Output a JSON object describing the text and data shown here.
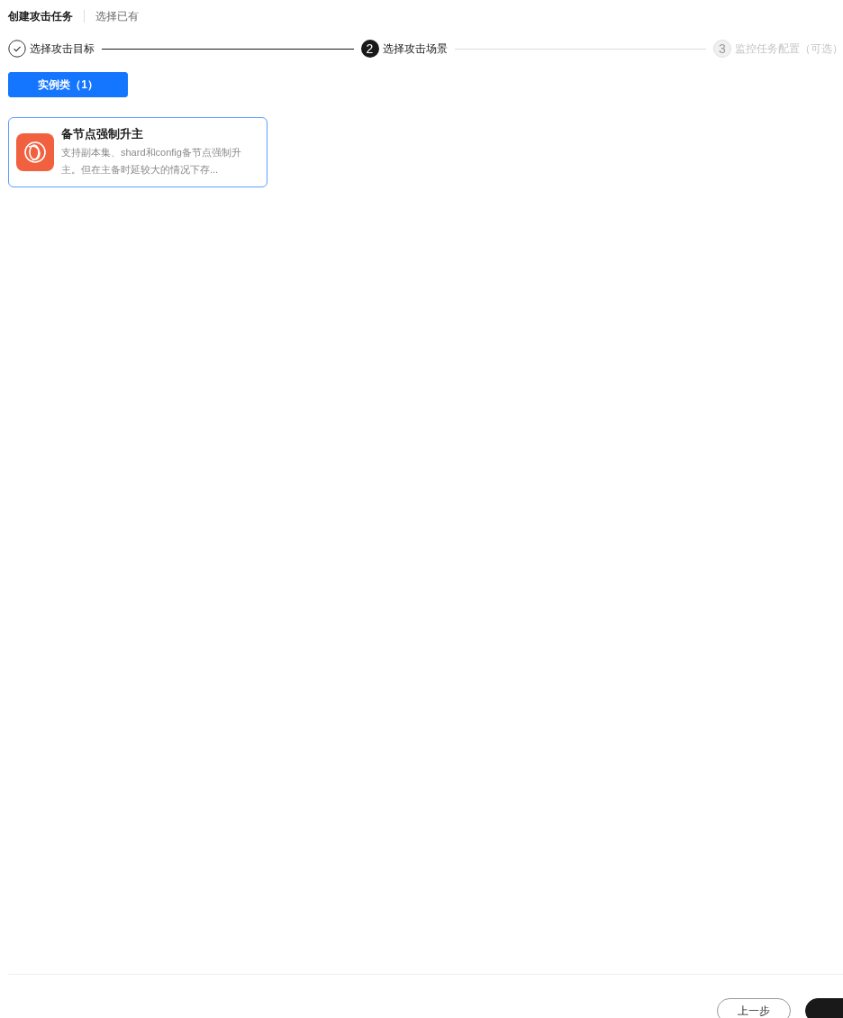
{
  "header_tabs": [
    {
      "label": "创建攻击任务",
      "selected": true
    },
    {
      "label": "选择已有",
      "selected": false
    }
  ],
  "steps": [
    {
      "label": "选择攻击目标",
      "kind": "done"
    },
    {
      "number": "2",
      "label": "选择攻击场景",
      "kind": "current"
    },
    {
      "number": "3",
      "label": "监控任务配置（可选）",
      "kind": "pending"
    }
  ],
  "category_tabs": [
    {
      "label": "实例类（1）",
      "selected": true
    }
  ],
  "scenarios": [
    {
      "title": "备节点强制升主",
      "description": "支持副本集、shard和config备节点强制升主。但在主备时延较大的情况下存...",
      "selected": true
    }
  ],
  "footer": {
    "buttons": [
      {
        "label": "上一步",
        "kind": "secondary"
      },
      {
        "kind": "primary"
      }
    ]
  }
}
